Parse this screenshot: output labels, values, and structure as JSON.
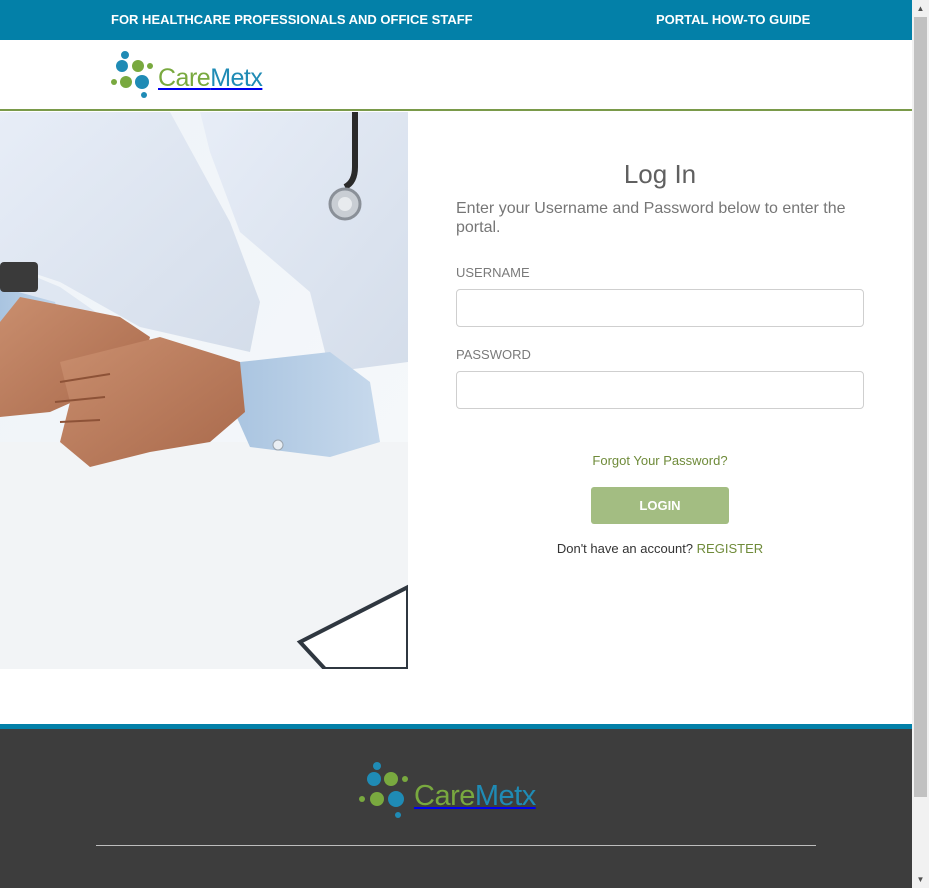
{
  "topbar": {
    "professionals_link": "FOR HEALTHCARE PROFESSIONALS AND OFFICE STAFF",
    "guide_link": "PORTAL HOW-TO GUIDE"
  },
  "brand": {
    "name_part1": "Care",
    "name_part2": "Metx",
    "colors": {
      "green": "#79a93f",
      "blue": "#1f8bb5",
      "topbar": "#0380a8",
      "footer": "#3d3d3d",
      "button": "#a3bd82"
    }
  },
  "login": {
    "title": "Log In",
    "subtitle": "Enter your Username and Password below to enter the portal.",
    "username_label": "USERNAME",
    "username_value": "",
    "password_label": "PASSWORD",
    "password_value": "",
    "forgot_link": "Forgot Your Password?",
    "login_button": "LOGIN",
    "no_account_text": "Don't have an account?",
    "register_link": "REGISTER"
  },
  "icons": {
    "scroll_up": "scroll-up-arrow-icon",
    "scroll_down": "scroll-down-arrow-icon"
  }
}
